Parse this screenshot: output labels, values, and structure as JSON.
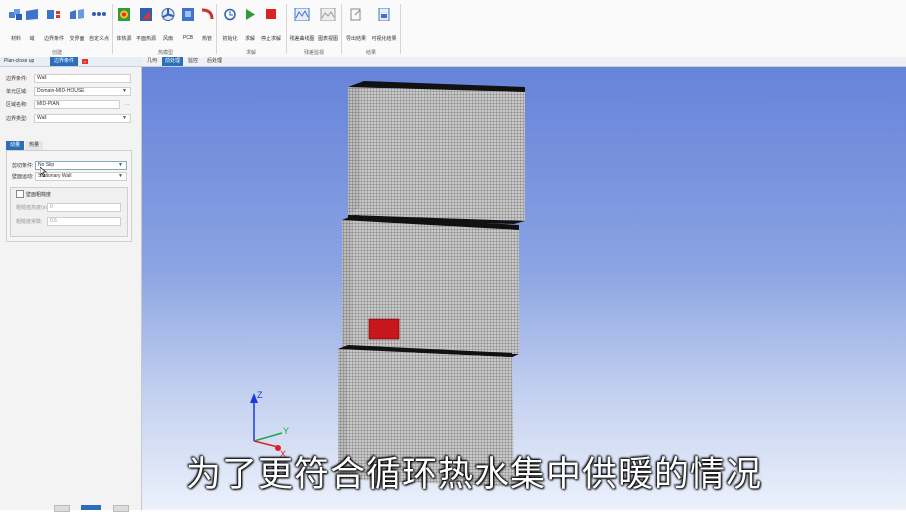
{
  "ribbon": {
    "groups": [
      {
        "label": "创建",
        "items": [
          "材料",
          "域",
          "边界条件",
          "交界面",
          "自定义点"
        ]
      },
      {
        "label": "热模型",
        "items": [
          "体热源",
          "平面热源",
          "风扇",
          "PCB",
          "热管"
        ]
      },
      {
        "label": "求解",
        "items": [
          "初始化",
          "求解",
          "停止求解"
        ]
      },
      {
        "label": "残差监视",
        "items": [
          "残差曲线图",
          "图表视图"
        ]
      },
      {
        "label": "结果",
        "items": [
          "导出结果",
          "可视化结果"
        ]
      }
    ]
  },
  "left_tabs": {
    "tab1": "Plan-close up",
    "tab2": "边界条件"
  },
  "viewport_tabs": [
    "几何",
    "前处理",
    "监控",
    "后处理"
  ],
  "form": {
    "boundary_label": "边界条件:",
    "boundary_value": "Wall",
    "domain_label": "单元区域:",
    "domain_value": "Domain-MID-HOUSE",
    "region_label": "区域名称:",
    "region_value": "MID-PIAN",
    "region_more": "...",
    "btype_label": "边界类型:",
    "btype_value": "Wall"
  },
  "sub_tabs": {
    "momentum": "动量",
    "thermal": "热量"
  },
  "momentum": {
    "shear_label": "剪切条件:",
    "shear_value": "No Slip",
    "wall_motion_label": "壁面运动:",
    "wall_motion_value": "Stationary Wall",
    "roughness_checkbox": "壁面粗糙度",
    "rough_height_label": "粗糙度高度(m):",
    "rough_height_value": "0",
    "rough_const_label": "粗糙度常数:",
    "rough_const_value": "0.5"
  },
  "axes": {
    "x": "X",
    "y": "Y",
    "z": "Z"
  },
  "subtitle": "为了更符合循环热水集中供暖的情况"
}
